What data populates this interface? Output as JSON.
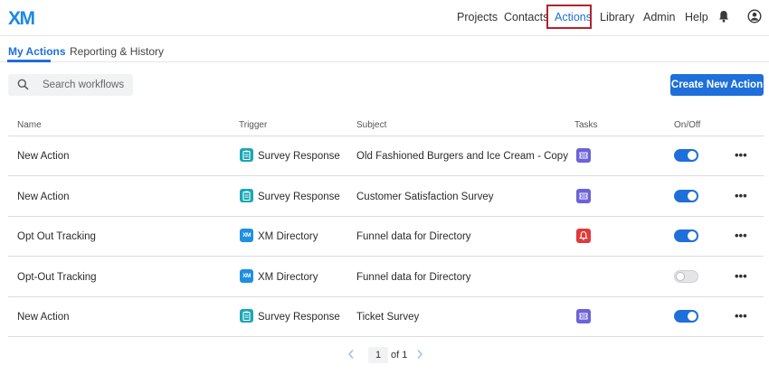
{
  "brand": {
    "logo": "XM"
  },
  "topnav": {
    "items": [
      "Projects",
      "Contacts",
      "Actions",
      "Library",
      "Admin",
      "Help"
    ],
    "active": "Actions"
  },
  "tabs": [
    "My Actions",
    "Reporting & History"
  ],
  "search": {
    "placeholder": "Search workflows"
  },
  "create_button": "Create New Action",
  "table": {
    "columns": [
      "Name",
      "Trigger",
      "Subject",
      "Tasks",
      "On/Off"
    ],
    "rows": [
      {
        "name": "New Action",
        "trigger": "Survey Response",
        "trigger_icon": "clipboard-icon",
        "subject": "Old Fashioned Burgers and Ice Cream - Copy",
        "task_icon": "ticket-icon",
        "enabled": true
      },
      {
        "name": "New Action",
        "trigger": "Survey Response",
        "trigger_icon": "clipboard-icon",
        "subject": "Customer Satisfaction Survey",
        "task_icon": "ticket-icon",
        "enabled": true
      },
      {
        "name": "Opt Out Tracking",
        "trigger": "XM Directory",
        "trigger_icon": "xm-directory-icon",
        "xm_badge": "XM",
        "subject": "Funnel data for Directory",
        "task_icon": "bell-alert-icon",
        "enabled": true
      },
      {
        "name": "Opt-Out Tracking",
        "trigger": "XM Directory",
        "trigger_icon": "xm-directory-icon",
        "xm_badge": "XM",
        "subject": "Funnel data for Directory",
        "task_icon": "",
        "enabled": false
      },
      {
        "name": "New Action",
        "trigger": "Survey Response",
        "trigger_icon": "clipboard-icon",
        "subject": "Ticket Survey",
        "task_icon": "ticket-icon",
        "enabled": true
      }
    ]
  },
  "pagination": {
    "page": "1",
    "of_label": "of 1"
  },
  "colors": {
    "accent": "#1e6fd9",
    "highlight_border": "#b3222f",
    "ticket": "#6c63d8",
    "alert": "#e03a3a",
    "survey": "#1aa7b5"
  }
}
